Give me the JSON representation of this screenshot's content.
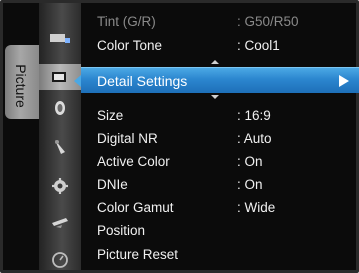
{
  "category": {
    "label": "Picture"
  },
  "icons": [
    {
      "name": "input-icon"
    },
    {
      "name": "picture-icon"
    },
    {
      "name": "sound-icon"
    },
    {
      "name": "channel-icon"
    },
    {
      "name": "setup-icon"
    },
    {
      "name": "application-icon"
    },
    {
      "name": "support-icon"
    }
  ],
  "menu": {
    "items_top": [
      {
        "label": "Tint (G/R)",
        "value": ": G50/R50",
        "disabled": true
      },
      {
        "label": "Color Tone",
        "value": ": Cool1"
      }
    ],
    "selected": {
      "label": "Detail Settings"
    },
    "items_bottom": [
      {
        "label": "Size",
        "value": ": 16:9"
      },
      {
        "label": "Digital NR",
        "value": ": Auto"
      },
      {
        "label": "Active Color",
        "value": ": On"
      },
      {
        "label": "DNIe",
        "value": ": On"
      },
      {
        "label": "Color Gamut",
        "value": ": Wide"
      },
      {
        "label": "Position",
        "value": ""
      },
      {
        "label": "Picture Reset",
        "value": ""
      }
    ]
  },
  "colors": {
    "highlight": "#2b86cf",
    "text": "#f1f1f1",
    "disabled_text": "#8a8a8a",
    "background": "#0b0b0b"
  }
}
